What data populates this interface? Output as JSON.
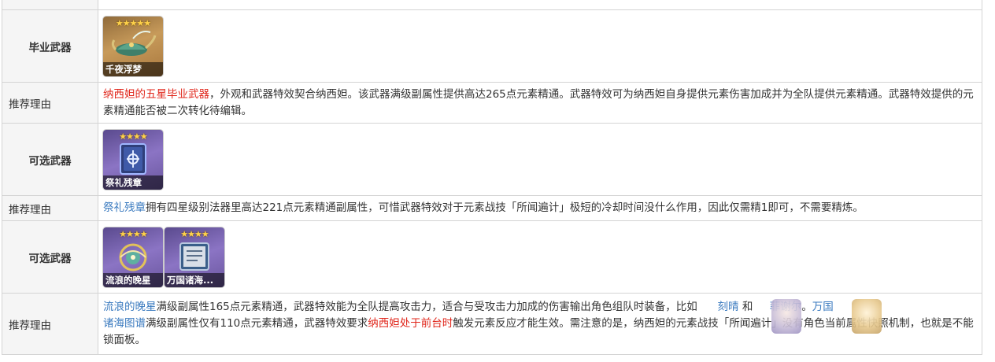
{
  "rows": {
    "best_weapon": {
      "label": "毕业武器",
      "weapons": [
        {
          "name": "千夜浮梦",
          "stars": "★★★★★",
          "rarity": 5
        }
      ]
    },
    "reason1": {
      "label": "推荐理由",
      "highlight": "纳西妲的五星毕业武器",
      "text": "，外观和武器特效契合纳西妲。该武器满级副属性提供高达265点元素精通。武器特效可为纳西妲自身提供元素伤害加成并为全队提供元素精通。武器特效提供的元素精通能否被二次转化待编辑。"
    },
    "alt_weapon1": {
      "label": "可选武器",
      "weapons": [
        {
          "name": "祭礼残章",
          "stars": "★★★★",
          "rarity": 4
        }
      ]
    },
    "reason2": {
      "label": "推荐理由",
      "link": "祭礼残章",
      "text": "拥有四星级别法器里高达221点元素精通副属性，可惜武器特效对于元素战技「所闻遍计」极短的冷却时间没什么作用，因此仅需精1即可，不需要精炼。"
    },
    "alt_weapon2": {
      "label": "可选武器",
      "weapons": [
        {
          "name": "流浪的晚星",
          "stars": "★★★★",
          "rarity": 4
        },
        {
          "name": "万国诸海...",
          "stars": "★★★★",
          "rarity": 4
        }
      ]
    },
    "reason3": {
      "label": "推荐理由",
      "link1": "流浪的晚星",
      "text1": "满级副属性165点元素精通，武器特效能为全队提高攻击力，适合与受攻击力加成的伤害输出角色组队时装备，比如",
      "char1": "刻晴",
      "and": "和",
      "char2": "菲谢尔",
      "sep": "。",
      "link2a": "万国",
      "link2b": "诸海图谱",
      "text2": "满级副属性仅有110点元素精通，武器特效要求",
      "highlight": "纳西妲处于前台时",
      "text3": "触发元素反应才能生效。需注意的是，纳西妲的元素战技「所闻遍计」没有角色当前属性快照机制，也就是不能锁面板。"
    }
  },
  "colors": {
    "highlight": "#e0251a",
    "link": "#3a7abf",
    "label_bg": "#f5f5f5",
    "border": "#d4d4d4"
  }
}
